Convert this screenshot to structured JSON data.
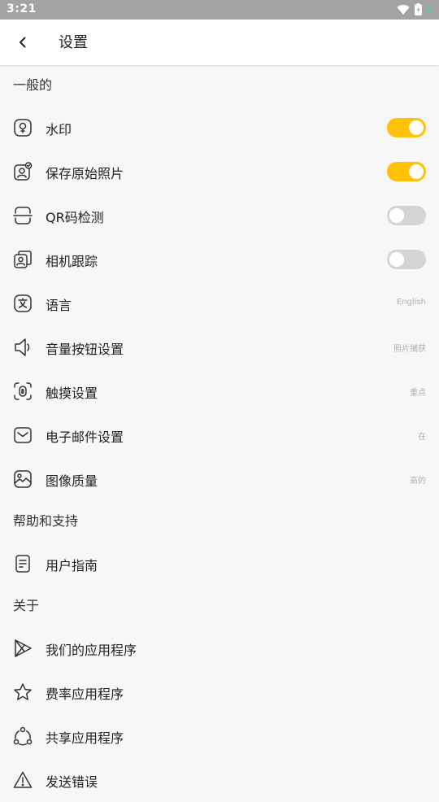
{
  "status_bar": {
    "time": "3:21"
  },
  "header": {
    "title": "设置"
  },
  "sections": {
    "general": {
      "title": "一般的",
      "watermark": {
        "label": "水印",
        "enabled": true
      },
      "save_original": {
        "label": "保存原始照片",
        "enabled": true
      },
      "qr_detect": {
        "label": "QR码检测",
        "enabled": false
      },
      "camera_tracking": {
        "label": "相机跟踪",
        "enabled": false
      },
      "language": {
        "label": "语言",
        "value": "English"
      },
      "volume_button": {
        "label": "音量按钮设置",
        "value": "照片捕获"
      },
      "touch": {
        "label": "触摸设置",
        "value": "重点"
      },
      "email": {
        "label": "电子邮件设置",
        "value": "在"
      },
      "image_quality": {
        "label": "图像质量",
        "value": "高的"
      }
    },
    "help": {
      "title": "帮助和支持",
      "user_guide": {
        "label": "用户指南"
      }
    },
    "about": {
      "title": "关于",
      "our_apps": {
        "label": "我们的应用程序"
      },
      "rate_app": {
        "label": "费率应用程序"
      },
      "share_app": {
        "label": "共享应用程序"
      },
      "send_bug": {
        "label": "发送错误"
      }
    }
  },
  "colors": {
    "accent": "#ffc107",
    "toggle_off": "#d4d4d4",
    "background": "#f7f7f7"
  },
  "icons": [
    "back-arrow-icon",
    "watermark-icon",
    "photo-icon",
    "qr-scan-icon",
    "camera-track-icon",
    "language-icon",
    "volume-icon",
    "touch-icon",
    "email-icon",
    "image-icon",
    "guide-icon",
    "play-store-icon",
    "star-icon",
    "share-icon",
    "warning-icon",
    "wifi-icon",
    "battery-icon"
  ]
}
